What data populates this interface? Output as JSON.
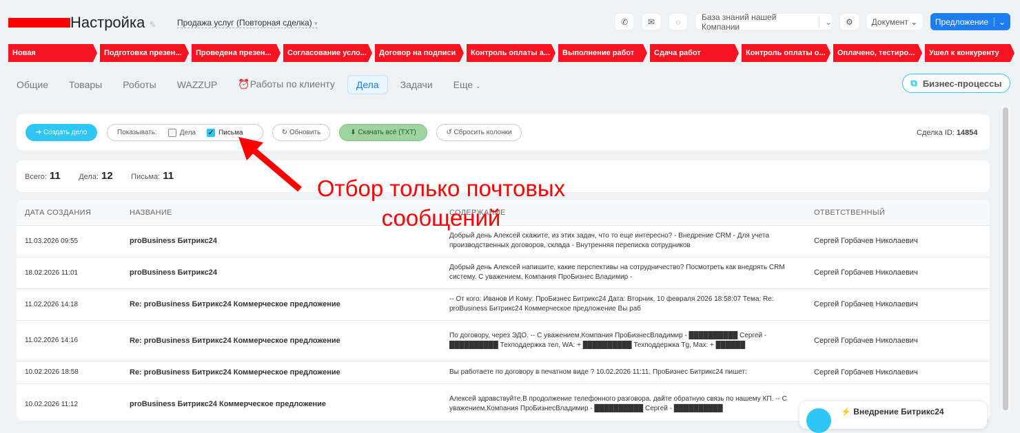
{
  "header": {
    "title": "Настройка",
    "deal_type": "Продажа услуг (Повторная сделка)",
    "knowledge_base": "База знаний нашей Компании",
    "document": "Документ",
    "offer": "Предложение"
  },
  "stages": [
    "Новая",
    "Подготовка презен...",
    "Проведена презен...",
    "Согласование усло...",
    "Договор на подписи",
    "Контроль оплаты а...",
    "Выполнение работ",
    "Сдача работ",
    "Контроль оплаты о...",
    "Оплачено, тестиро...",
    "Ушел к конкуренту"
  ],
  "tabs": [
    "Общие",
    "Товары",
    "Роботы",
    "WAZZUP",
    "Работы по клиенту",
    "Дела",
    "Задачи",
    "Еще"
  ],
  "business_processes": "Бизнес-процессы",
  "toolbar": {
    "create": "➔ Создать дело",
    "show_label": "Показывать:",
    "filter_tasks": "Дела",
    "filter_letters": "Письма",
    "refresh": "↻ Обновить",
    "download": "⬇ Скачать всё (TXT)",
    "reset": "↺ Сбросить колонки",
    "deal_id_label": "Сделка ID:",
    "deal_id": "14854"
  },
  "stats": {
    "total_label": "Всего:",
    "total": "11",
    "tasks_label": "Дела:",
    "tasks": "12",
    "letters_label": "Письма:",
    "letters": "11"
  },
  "annotation": "Отбор только почтовых сообщений",
  "table": {
    "headers": [
      "ДАТА СОЗДАНИЯ",
      "НАЗВАНИЕ",
      "СОДЕРЖАНИЕ",
      "ОТВЕТСТВЕННЫЙ"
    ],
    "rows": [
      {
        "date": "11.03.2026 09:55",
        "name": "proBusiness Битрикс24",
        "content": "Добрый день Алексей скажите, из этих задач, что то еще интересно? - Внедрение CRM - Для учета производственных договоров, склада - Внутренняя переписка сотрудников",
        "resp": "Сергей Горбачев Николаевич"
      },
      {
        "date": "18.02.2026 11:01",
        "name": "proBusiness Битрикс24",
        "content": "Добрый день Алексей напишите, какие перспективы на сотрудничество? Посмотреть как внедрять CRM систему. С уважением, Компания ПроБизнес Владимир -",
        "resp": "Сергей Горбачев Николаевич"
      },
      {
        "date": "11.02.2026 14:18",
        "name": "Re: proBusiness Битрикс24 Коммерческое предложение",
        "content": "-- От кого: Иванов И Кому: ПроБизнес Битрикс24 Дата: Вторник, 10 февраля 2026 18:58:07 Тема: Re: proBusiness Битрикс24 Коммерческое предложение Вы раб",
        "resp": "Сергей Горбачев Николаевич"
      },
      {
        "date": "11.02.2026 14:16",
        "name": "Re: proBusiness Битрикс24 Коммерческое предложение",
        "content": "По договору, через ЭДО. -- С уважением,Компания ПроБизнесВладимир - ██████████ Сергей - ██████████ Техподдержка тел, WA: + ██████████ Техподдержка Tg, Max: + ██████",
        "resp": "Сергей Горбачев Николаевич"
      },
      {
        "date": "10.02.2026 18:58",
        "name": "Re: proBusiness Битрикс24 Коммерческое предложение",
        "content": "Вы работаете по договору в печатном виде ? 10.02.2026 11:11, ПроБизнес Битрикс24 пишет:",
        "resp": "Сергей Горбачев Николаевич"
      },
      {
        "date": "10.02.2026 11:12",
        "name": "proBusiness Битрикс24 Коммерческое предложение",
        "content": "Алексей здравствуйте.В продолжение телефонного разговора. дайте обратную связь по нашему КП. -- С уважением,Компания ПроБизнесВладимир - ██████████ Сергей - ██████████",
        "resp": ""
      }
    ]
  },
  "popup": {
    "title": "Внедрение Битрикс24"
  }
}
